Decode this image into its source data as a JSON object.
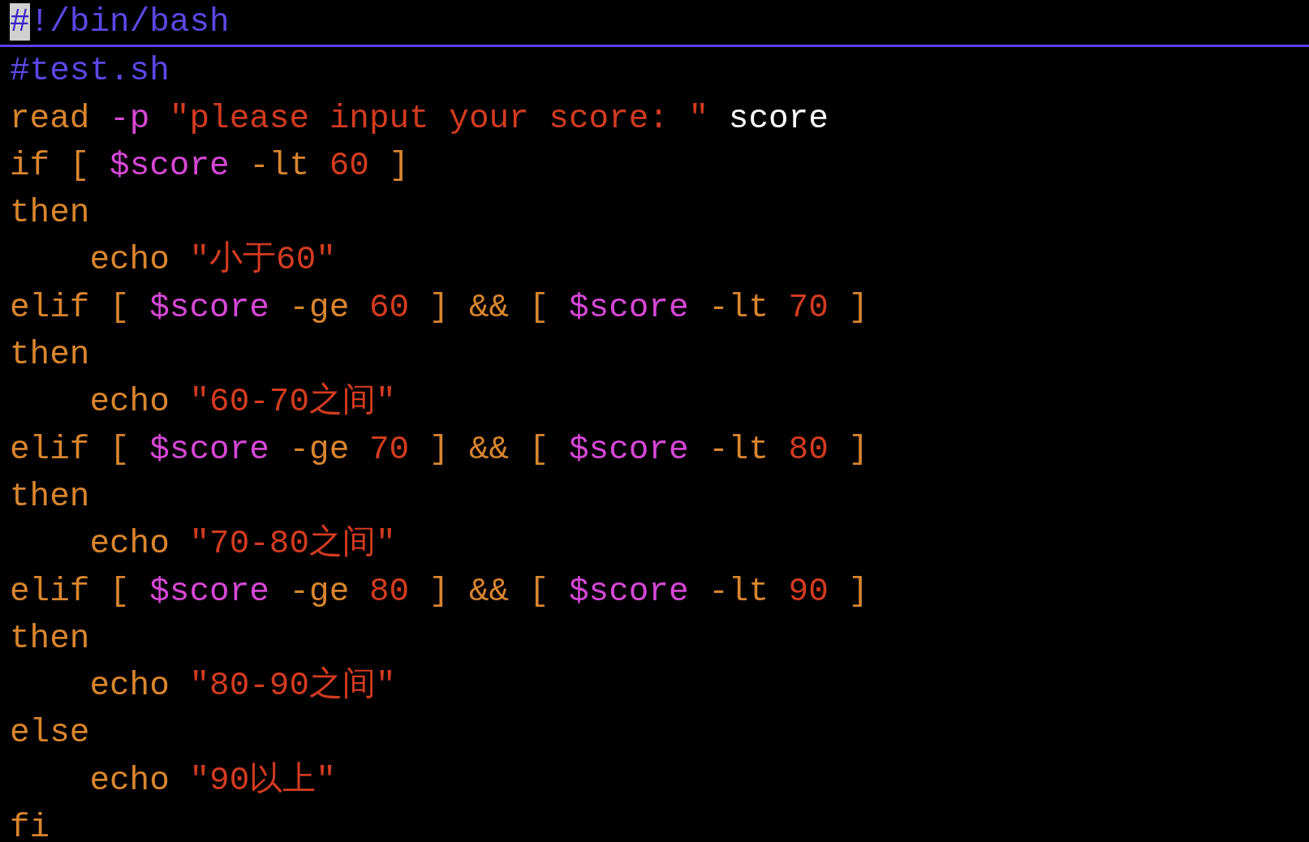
{
  "editor": {
    "lines": [
      {
        "current": true,
        "tokens": [
          {
            "text": "#!/bin/bash",
            "kind": "comment"
          }
        ]
      },
      {
        "current": false,
        "tokens": [
          {
            "text": "#test.sh",
            "kind": "comment"
          }
        ]
      },
      {
        "current": false,
        "tokens": [
          {
            "text": "read ",
            "kind": "keyword"
          },
          {
            "text": "-p",
            "kind": "variable"
          },
          {
            "text": " \"please input your score: \"",
            "kind": "string"
          },
          {
            "text": " score",
            "kind": "plain"
          }
        ]
      },
      {
        "current": false,
        "tokens": [
          {
            "text": "if [ ",
            "kind": "keyword"
          },
          {
            "text": "$score",
            "kind": "variable"
          },
          {
            "text": " -lt ",
            "kind": "keyword"
          },
          {
            "text": "60",
            "kind": "string"
          },
          {
            "text": " ]",
            "kind": "keyword"
          }
        ]
      },
      {
        "current": false,
        "tokens": [
          {
            "text": "then",
            "kind": "keyword"
          }
        ]
      },
      {
        "current": false,
        "tokens": [
          {
            "text": "    echo ",
            "kind": "keyword"
          },
          {
            "text": "\"小于60\"",
            "kind": "string"
          }
        ]
      },
      {
        "current": false,
        "tokens": [
          {
            "text": "elif [ ",
            "kind": "keyword"
          },
          {
            "text": "$score",
            "kind": "variable"
          },
          {
            "text": " -ge ",
            "kind": "keyword"
          },
          {
            "text": "60",
            "kind": "string"
          },
          {
            "text": " ] && [ ",
            "kind": "keyword"
          },
          {
            "text": "$score",
            "kind": "variable"
          },
          {
            "text": " -lt ",
            "kind": "keyword"
          },
          {
            "text": "70",
            "kind": "string"
          },
          {
            "text": " ]",
            "kind": "keyword"
          }
        ]
      },
      {
        "current": false,
        "tokens": [
          {
            "text": "then",
            "kind": "keyword"
          }
        ]
      },
      {
        "current": false,
        "tokens": [
          {
            "text": "    echo ",
            "kind": "keyword"
          },
          {
            "text": "\"60-70之间\"",
            "kind": "string"
          }
        ]
      },
      {
        "current": false,
        "tokens": [
          {
            "text": "elif [ ",
            "kind": "keyword"
          },
          {
            "text": "$score",
            "kind": "variable"
          },
          {
            "text": " -ge ",
            "kind": "keyword"
          },
          {
            "text": "70",
            "kind": "string"
          },
          {
            "text": " ] && [ ",
            "kind": "keyword"
          },
          {
            "text": "$score",
            "kind": "variable"
          },
          {
            "text": " -lt ",
            "kind": "keyword"
          },
          {
            "text": "80",
            "kind": "string"
          },
          {
            "text": " ]",
            "kind": "keyword"
          }
        ]
      },
      {
        "current": false,
        "tokens": [
          {
            "text": "then",
            "kind": "keyword"
          }
        ]
      },
      {
        "current": false,
        "tokens": [
          {
            "text": "    echo ",
            "kind": "keyword"
          },
          {
            "text": "\"70-80之间\"",
            "kind": "string"
          }
        ]
      },
      {
        "current": false,
        "tokens": [
          {
            "text": "elif [ ",
            "kind": "keyword"
          },
          {
            "text": "$score",
            "kind": "variable"
          },
          {
            "text": " -ge ",
            "kind": "keyword"
          },
          {
            "text": "80",
            "kind": "string"
          },
          {
            "text": " ] && [ ",
            "kind": "keyword"
          },
          {
            "text": "$score",
            "kind": "variable"
          },
          {
            "text": " -lt ",
            "kind": "keyword"
          },
          {
            "text": "90",
            "kind": "string"
          },
          {
            "text": " ]",
            "kind": "keyword"
          }
        ]
      },
      {
        "current": false,
        "tokens": [
          {
            "text": "then",
            "kind": "keyword"
          }
        ]
      },
      {
        "current": false,
        "tokens": [
          {
            "text": "    echo ",
            "kind": "keyword"
          },
          {
            "text": "\"80-90之间\"",
            "kind": "string"
          }
        ]
      },
      {
        "current": false,
        "tokens": [
          {
            "text": "else",
            "kind": "keyword"
          }
        ]
      },
      {
        "current": false,
        "tokens": [
          {
            "text": "    echo ",
            "kind": "keyword"
          },
          {
            "text": "\"90以上\"",
            "kind": "string"
          }
        ]
      },
      {
        "current": false,
        "tokens": [
          {
            "text": "fi",
            "kind": "keyword"
          }
        ]
      }
    ]
  }
}
